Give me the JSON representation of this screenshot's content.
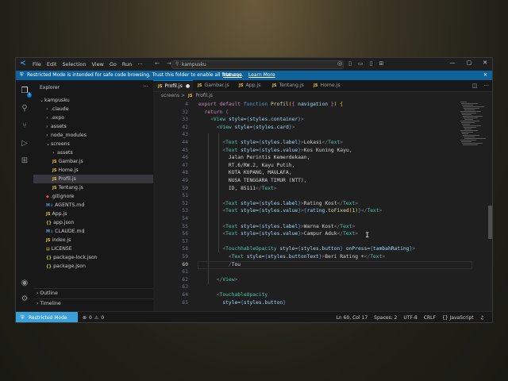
{
  "titlebar": {
    "menu": [
      "File",
      "Edit",
      "Selection",
      "View",
      "Go",
      "Run",
      "···"
    ],
    "search": "kampusku",
    "nav_back": "←",
    "nav_fwd": "→"
  },
  "banner": {
    "message": "Restricted Mode is intended for safe code browsing. Trust this folder to enable all features.",
    "manage": "Manage",
    "learn_more": "Learn More"
  },
  "sidebar": {
    "title": "Explorer",
    "tree": [
      {
        "label": "kampusku",
        "kind": "folder-open",
        "indent": 0
      },
      {
        "label": ".claude",
        "kind": "folder",
        "indent": 1
      },
      {
        "label": ".expo",
        "kind": "folder",
        "indent": 1
      },
      {
        "label": "assets",
        "kind": "folder",
        "indent": 1
      },
      {
        "label": "node_modules",
        "kind": "folder",
        "indent": 1
      },
      {
        "label": "screens",
        "kind": "folder-open",
        "indent": 1
      },
      {
        "label": "assets",
        "kind": "folder",
        "indent": 2
      },
      {
        "label": "Gambar.js",
        "kind": "js",
        "indent": 2
      },
      {
        "label": "Home.js",
        "kind": "js",
        "indent": 2
      },
      {
        "label": "Profil.js",
        "kind": "js",
        "indent": 2,
        "selected": true
      },
      {
        "label": "Tentang.js",
        "kind": "js",
        "indent": 2
      },
      {
        "label": ".gitignore",
        "kind": "git",
        "indent": 1
      },
      {
        "label": "AGENTS.md",
        "kind": "md",
        "indent": 1
      },
      {
        "label": "App.js",
        "kind": "js",
        "indent": 1
      },
      {
        "label": "app.json",
        "kind": "json",
        "indent": 1
      },
      {
        "label": "CLAUDE.md",
        "kind": "md",
        "indent": 1
      },
      {
        "label": "index.js",
        "kind": "js",
        "indent": 1
      },
      {
        "label": "LICENSE",
        "kind": "lic",
        "indent": 1
      },
      {
        "label": "package-lock.json",
        "kind": "json",
        "indent": 1
      },
      {
        "label": "package.json",
        "kind": "json",
        "indent": 1
      }
    ],
    "outline": "Outline",
    "timeline": "Timeline"
  },
  "tabs": [
    {
      "label": "Profil.js",
      "active": true,
      "modified": true
    },
    {
      "label": "Gambar.js"
    },
    {
      "label": "App.js"
    },
    {
      "label": "Tentang.js"
    },
    {
      "label": "Home.js"
    }
  ],
  "breadcrumb": {
    "folder": "screens",
    "sep": ">",
    "file": "Profil.js"
  },
  "code": [
    {
      "n": "4",
      "html": "<span class=\"kw\">export default</span> <span class=\"kw2\">function</span> <span class=\"fn\">Profil</span><span class=\"br\">(</span><span class=\"pu\">{</span> <span class=\"at\">navigation</span> <span class=\"pu\">}</span><span class=\"br\">)</span> <span class=\"br\">{</span>"
    },
    {
      "n": "32",
      "html": "  <span class=\"kw\">return</span> <span class=\"pu\">(</span>"
    },
    {
      "n": "33",
      "html": "    <span class=\"mm\">&lt;</span><span class=\"tg\">View</span> <span class=\"at\">style</span>=<span class=\"kw2\">{</span><span class=\"at\">styles</span>.<span class=\"at\">container</span><span class=\"kw2\">}</span><span class=\"mm\">&gt;</span>"
    },
    {
      "n": "42",
      "html": "      <span class=\"mm\">&lt;</span><span class=\"tg\">View</span> <span class=\"at\">style</span>=<span class=\"kw2\">{</span><span class=\"at\">styles</span>.<span class=\"at\">card</span><span class=\"kw2\">}</span><span class=\"mm\">&gt;</span>"
    },
    {
      "n": "43",
      "html": ""
    },
    {
      "n": "44",
      "html": "        <span class=\"mm\">&lt;</span><span class=\"tg\">Text</span> <span class=\"at\">style</span>=<span class=\"kw2\">{</span><span class=\"at\">styles</span>.<span class=\"at\">label</span><span class=\"kw2\">}</span><span class=\"mm\">&gt;</span>Lokasi<span class=\"mm\">&lt;/</span><span class=\"tg\">Text</span><span class=\"mm\">&gt;</span>"
    },
    {
      "n": "45",
      "html": "        <span class=\"mm\">&lt;</span><span class=\"tg\">Text</span> <span class=\"at\">style</span>=<span class=\"kw2\">{</span><span class=\"at\">styles</span>.<span class=\"at\">value</span><span class=\"kw2\">}</span><span class=\"mm\">&gt;</span>Kos Kuning Kayu,"
    },
    {
      "n": "46",
      "html": "          Jalan Perintis Kemerdekaan,"
    },
    {
      "n": "47",
      "html": "          RT.6/RW.2, Kayu Putih,"
    },
    {
      "n": "48",
      "html": "          KOTA KUPANG, MAULAFA,"
    },
    {
      "n": "49",
      "html": "          NUSA TENGGARA TIMUR (NTT),"
    },
    {
      "n": "50",
      "html": "          ID, 85111<span class=\"mm\">&lt;/</span><span class=\"tg\">Text</span><span class=\"mm\">&gt;</span>"
    },
    {
      "n": "51",
      "html": ""
    },
    {
      "n": "52",
      "html": "        <span class=\"mm\">&lt;</span><span class=\"tg\">Text</span> <span class=\"at\">style</span>=<span class=\"kw2\">{</span><span class=\"at\">styles</span>.<span class=\"at\">label</span><span class=\"kw2\">}</span><span class=\"mm\">&gt;</span>Rating Kost<span class=\"mm\">&lt;/</span><span class=\"tg\">Text</span><span class=\"mm\">&gt;</span>"
    },
    {
      "n": "53",
      "html": "        <span class=\"mm\">&lt;</span><span class=\"tg\">Text</span> <span class=\"at\">style</span>=<span class=\"kw2\">{</span><span class=\"at\">styles</span>.<span class=\"at\">value</span><span class=\"kw2\">}</span><span class=\"mm\">&gt;</span><span class=\"kw2\">{</span><span class=\"at\">rating</span>.<span class=\"fn\">toFixed</span><span class=\"br\">(</span>1<span class=\"br\">)</span><span class=\"kw2\">}</span><span class=\"mm\">&lt;/</span><span class=\"tg\">Text</span><span class=\"mm\">&gt;</span>"
    },
    {
      "n": "54",
      "html": ""
    },
    {
      "n": "55",
      "html": "        <span class=\"mm\">&lt;</span><span class=\"tg\">Text</span> <span class=\"at\">style</span>=<span class=\"kw2\">{</span><span class=\"at\">styles</span>.<span class=\"at\">label</span><span class=\"kw2\">}</span><span class=\"mm\">&gt;</span>Warna Kost<span class=\"mm\">&lt;/</span><span class=\"tg\">Text</span><span class=\"mm\">&gt;</span>"
    },
    {
      "n": "56",
      "html": "        <span class=\"mm\">&lt;</span><span class=\"tg\">Text</span> <span class=\"at\">style</span>=<span class=\"kw2\">{</span><span class=\"at\">styles</span>.<span class=\"at\">value</span><span class=\"kw2\">}</span><span class=\"mm\">&gt;</span>Campur Aduk<span class=\"mm\">&lt;/</span><span class=\"tg\">Text</span><span class=\"mm\">&gt;</span>"
    },
    {
      "n": "57",
      "html": ""
    },
    {
      "n": "58",
      "html": "        <span class=\"mm\">&lt;</span><span class=\"tg\">TouchhableOpacity</span> <span class=\"at\">style</span>=<span class=\"kw2\">{</span><span class=\"at\">styles</span>.<span class=\"at\">button</span><span class=\"kw2\">}</span> <span class=\"at\">onPress</span>=<span class=\"kw2\">{</span><span class=\"at\">tambahRating</span><span class=\"kw2\">}</span><span class=\"mm\">&gt;</span>"
    },
    {
      "n": "59",
      "html": "          <span class=\"mm\">&lt;</span><span class=\"tg\">Text</span> <span class=\"at\">style</span>=<span class=\"kw2\">{</span><span class=\"at\">styles</span>.<span class=\"at\">buttonText</span><span class=\"kw2\">}</span><span class=\"mm\">&gt;</span>Beri Rating +<span class=\"mm\">&lt;/</span><span class=\"tg\">Text</span><span class=\"mm\">&gt;</span>"
    },
    {
      "n": "60",
      "html": "          <span class=\"mm\">/</span>Tou",
      "current": true
    },
    {
      "n": "61",
      "html": ""
    },
    {
      "n": "62",
      "html": "      <span class=\"mm\">&lt;/</span><span class=\"tg\">View</span><span class=\"mm\">&gt;</span>"
    },
    {
      "n": "63",
      "html": ""
    },
    {
      "n": "64",
      "html": "      <span class=\"mm\">&lt;</span><span class=\"tg\">TouchableOpacity</span>"
    },
    {
      "n": "65",
      "html": "        <span class=\"at\">style</span>=<span class=\"kw2\">{</span><span class=\"at\">styles</span>.<span class=\"at\">button</span><span class=\"kw2\">}</span>"
    }
  ],
  "status": {
    "mode": "Restricted Mode",
    "errors": "0",
    "warnings": "0",
    "position": "Ln 60, Col 17",
    "spaces": "Spaces: 2",
    "encoding": "UTF-8",
    "eol": "CRLF",
    "language": "{} JavaScript"
  },
  "colors": {
    "accent": "#0078d4",
    "banner": "#0e639c",
    "restricted": "#3ca0d8"
  }
}
